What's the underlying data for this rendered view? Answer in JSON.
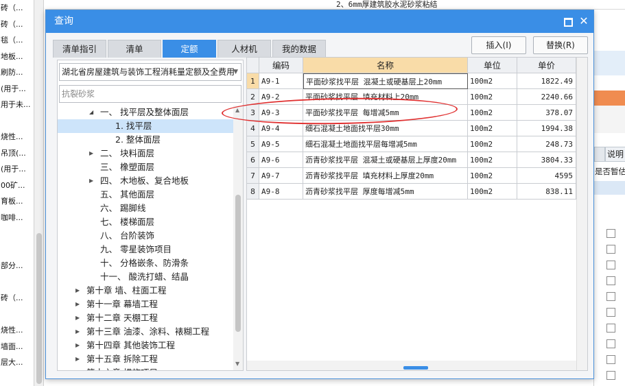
{
  "background": {
    "left_rows": [
      "砖（...",
      "砖（...",
      "毯（...",
      "地板...",
      "刷防...",
      "(用于...",
      "用于未...",
      "",
      "烧性...",
      "吊顶(...",
      "(用于...",
      "00矿...",
      "育板...",
      "咖啡...",
      "",
      "",
      "部分...",
      "",
      "砖（...",
      "",
      "烧性...",
      "墙面...",
      "层大..."
    ],
    "top_strip_text": "2、6mm厚建筑胶水泥砂浆粘结",
    "right_button_label": "说明",
    "right_label": "是否暂估"
  },
  "dialog": {
    "title": "查询",
    "tabs": [
      "清单指引",
      "清单",
      "定额",
      "人材机",
      "我的数据"
    ],
    "active_tab": 2,
    "insert_button": "插入(I)",
    "replace_button": "替换(R)",
    "dropdown_value": "湖北省房屋建筑与装饰工程消耗量定额及全费用",
    "search_value": "抗裂砂浆",
    "tree": [
      {
        "label": "一、 找平层及整体面层",
        "level": 1,
        "expand": "down"
      },
      {
        "label": "1. 找平层",
        "level": 3,
        "expand": "",
        "selected": true
      },
      {
        "label": "2. 整体面层",
        "level": 3,
        "expand": ""
      },
      {
        "label": "二、 块料面层",
        "level": 1,
        "expand": "right"
      },
      {
        "label": "三、 橡塑面层",
        "level": 1,
        "expand": ""
      },
      {
        "label": "四、 木地板、复合地板",
        "level": 1,
        "expand": "right"
      },
      {
        "label": "五、 其他面层",
        "level": 1,
        "expand": ""
      },
      {
        "label": "六、 踢脚线",
        "level": 1,
        "expand": ""
      },
      {
        "label": "七、 楼梯面层",
        "level": 1,
        "expand": ""
      },
      {
        "label": "八、 台阶装饰",
        "level": 1,
        "expand": ""
      },
      {
        "label": "九、 零星装饰项目",
        "level": 1,
        "expand": ""
      },
      {
        "label": "十、 分格嵌条、防滑条",
        "level": 1,
        "expand": ""
      },
      {
        "label": "十一、 酸洗打蜡、结晶",
        "level": 1,
        "expand": ""
      },
      {
        "label": "第十章 墙、柱面工程",
        "level": 0,
        "expand": "right"
      },
      {
        "label": "第十一章 幕墙工程",
        "level": 0,
        "expand": "right"
      },
      {
        "label": "第十二章 天棚工程",
        "level": 0,
        "expand": "right"
      },
      {
        "label": "第十三章 油漆、涂料、裱糊工程",
        "level": 0,
        "expand": "right"
      },
      {
        "label": "第十四章 其他装饰工程",
        "level": 0,
        "expand": "right"
      },
      {
        "label": "第十五章 拆除工程",
        "level": 0,
        "expand": "right"
      },
      {
        "label": "第十六章 措施项目",
        "level": 0,
        "expand": "right"
      }
    ],
    "table": {
      "headers": [
        "编码",
        "名称",
        "单位",
        "单价"
      ],
      "rows": [
        {
          "no": "1",
          "code": "A9-1",
          "name": "平面砂浆找平层 混凝土或硬基层上20mm",
          "unit": "100m2",
          "price": "1822.49"
        },
        {
          "no": "2",
          "code": "A9-2",
          "name": "平面砂浆找平层 填充材料上20mm",
          "unit": "100m2",
          "price": "2240.66"
        },
        {
          "no": "3",
          "code": "A9-3",
          "name": "平面砂浆找平层 每增减5mm",
          "unit": "100m2",
          "price": "378.07"
        },
        {
          "no": "4",
          "code": "A9-4",
          "name": "细石混凝土地面找平层30mm",
          "unit": "100m2",
          "price": "1994.38"
        },
        {
          "no": "5",
          "code": "A9-5",
          "name": "细石混凝土地面找平层每增减5mm",
          "unit": "100m2",
          "price": "248.73"
        },
        {
          "no": "6",
          "code": "A9-6",
          "name": "沥青砂浆找平层 混凝土或硬基层上厚度20mm",
          "unit": "100m2",
          "price": "3804.33"
        },
        {
          "no": "7",
          "code": "A9-7",
          "name": "沥青砂浆找平层 填充材料上厚度20mm",
          "unit": "100m2",
          "price": "4595"
        },
        {
          "no": "8",
          "code": "A9-8",
          "name": "沥青砂浆找平层 厚度每增减5mm",
          "unit": "100m2",
          "price": "838.11"
        }
      ],
      "selected_row": 0
    }
  },
  "colors": {
    "accent": "#3a8ee6",
    "name_header": "#f9dca8",
    "highlight_ellipse": "#e03030"
  }
}
